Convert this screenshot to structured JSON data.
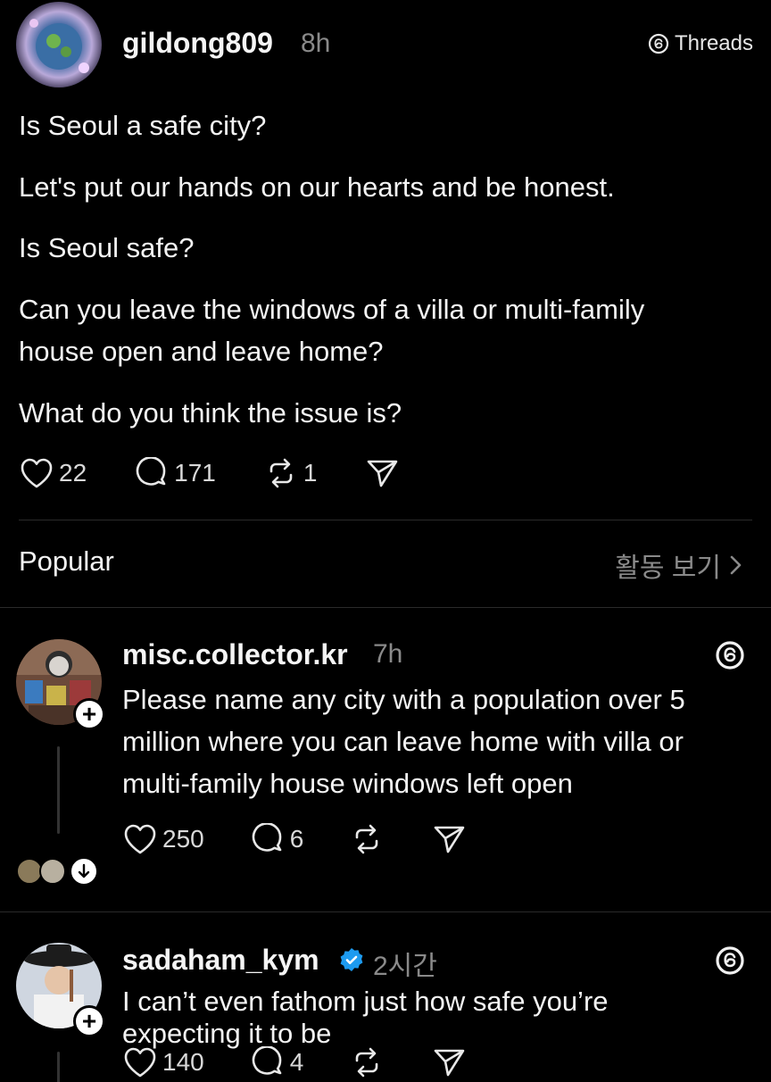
{
  "post": {
    "username": "gildong809",
    "time": "8h",
    "source_label": "Threads",
    "lines": [
      "Is Seoul a safe city?",
      "Let's put our hands on our hearts and be honest.",
      "Is Seoul safe?",
      "Can you leave the windows of a villa or multi-family",
      "house open and leave home?",
      "What do you think the issue is?"
    ],
    "likes": "22",
    "replies": "171",
    "reposts": "1"
  },
  "section": {
    "title": "Popular",
    "view_activity": "활동 보기"
  },
  "replies": [
    {
      "username": "misc.collector.kr",
      "time": "7h",
      "lines": [
        "Please name any city with a population over 5",
        "million where you can leave home with villa or",
        "multi-family house windows left open"
      ],
      "likes": "250",
      "replies": "6"
    },
    {
      "username": "sadaham_kym",
      "time": "2시간",
      "verified": true,
      "lines": [
        "I can’t even fathom just how safe you’re",
        "expecting it to be"
      ],
      "likes": "140",
      "replies": "4"
    }
  ],
  "icons": {
    "like": "heart-icon",
    "reply": "comment-icon",
    "repost": "repost-icon",
    "share": "send-icon",
    "threads": "threads-logo-icon",
    "verified": "verified-badge-icon",
    "chevron": "chevron-right-icon"
  },
  "colors": {
    "background": "#000000",
    "text": "#f3f3f3",
    "muted": "#8a8a8a",
    "verified": "#1d9bf0",
    "divider": "#2a2a2a"
  }
}
